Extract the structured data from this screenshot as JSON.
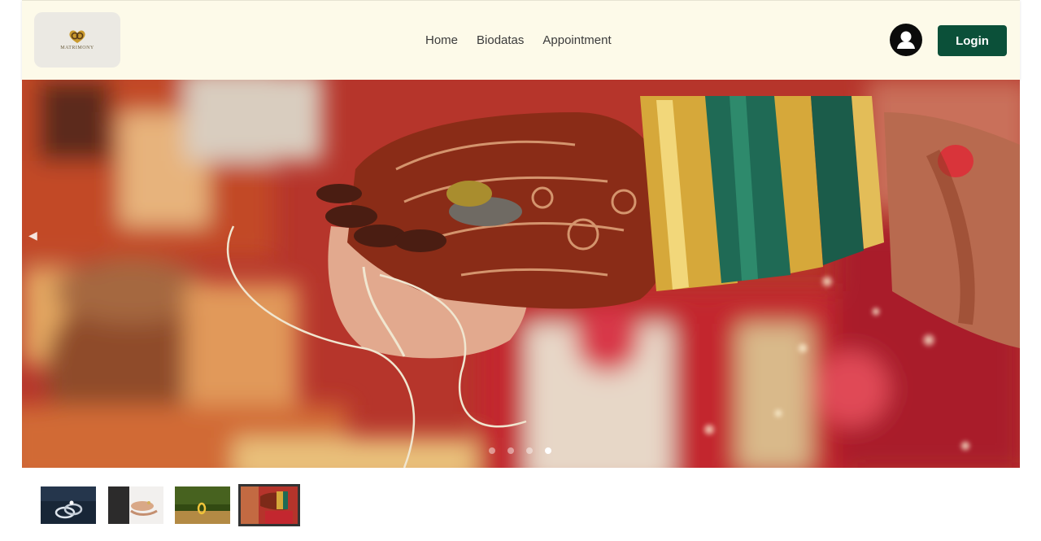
{
  "brand": {
    "logo_text": "MATRIMONY",
    "logo_icon": "heart-rings-icon"
  },
  "nav": {
    "items": [
      {
        "label": "Home"
      },
      {
        "label": "Biodatas"
      },
      {
        "label": "Appointment"
      }
    ]
  },
  "header": {
    "avatar_icon": "user-avatar-icon",
    "login_label": "Login"
  },
  "carousel": {
    "slide_count": 4,
    "active_index": 3,
    "prev_icon": "caret-left-icon"
  },
  "thumbnails": [
    {
      "subject": "rings",
      "active": false
    },
    {
      "subject": "hands",
      "active": false
    },
    {
      "subject": "ring-on-table",
      "active": false
    },
    {
      "subject": "mehndi-hands",
      "active": true
    }
  ],
  "colors": {
    "header_bg": "#fdfae9",
    "login_button": "#0b5039",
    "avatar_bg": "#0b0b0b"
  }
}
